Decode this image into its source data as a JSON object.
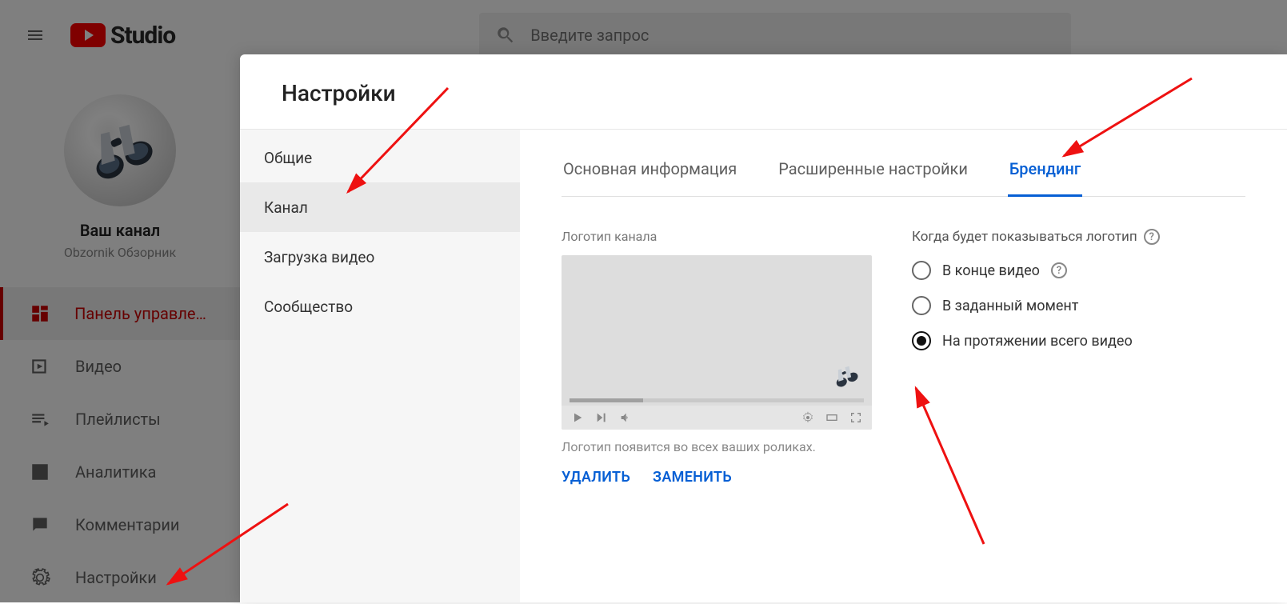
{
  "header": {
    "logo_text": "Studio",
    "search_placeholder": "Введите запрос"
  },
  "sidebar": {
    "your_channel": "Ваш канал",
    "channel_name": "Obzornik Обзорник",
    "items": [
      {
        "label": "Панель управлен…",
        "icon": "dashboard",
        "active": true
      },
      {
        "label": "Видео",
        "icon": "video"
      },
      {
        "label": "Плейлисты",
        "icon": "playlist"
      },
      {
        "label": "Аналитика",
        "icon": "analytics"
      },
      {
        "label": "Комментарии",
        "icon": "comments"
      },
      {
        "label": "Настройки",
        "icon": "gear"
      }
    ]
  },
  "modal": {
    "title": "Настройки",
    "side": [
      {
        "label": "Общие"
      },
      {
        "label": "Канал",
        "selected": true
      },
      {
        "label": "Загрузка видео"
      },
      {
        "label": "Сообщество"
      }
    ],
    "tabs": [
      {
        "label": "Основная информация"
      },
      {
        "label": "Расширенные настройки"
      },
      {
        "label": "Брендинг",
        "active": true
      }
    ],
    "branding": {
      "section_label": "Логотип канала",
      "help_text": "Логотип появится во всех ваших роликах.",
      "delete_label": "УДАЛИТЬ",
      "replace_label": "ЗАМЕНИТЬ",
      "when_shown_label": "Когда будет показываться логотип",
      "options": [
        {
          "label": "В конце видео",
          "with_help": true
        },
        {
          "label": "В заданный момент"
        },
        {
          "label": "На протяжении всего видео",
          "checked": true
        }
      ]
    }
  }
}
